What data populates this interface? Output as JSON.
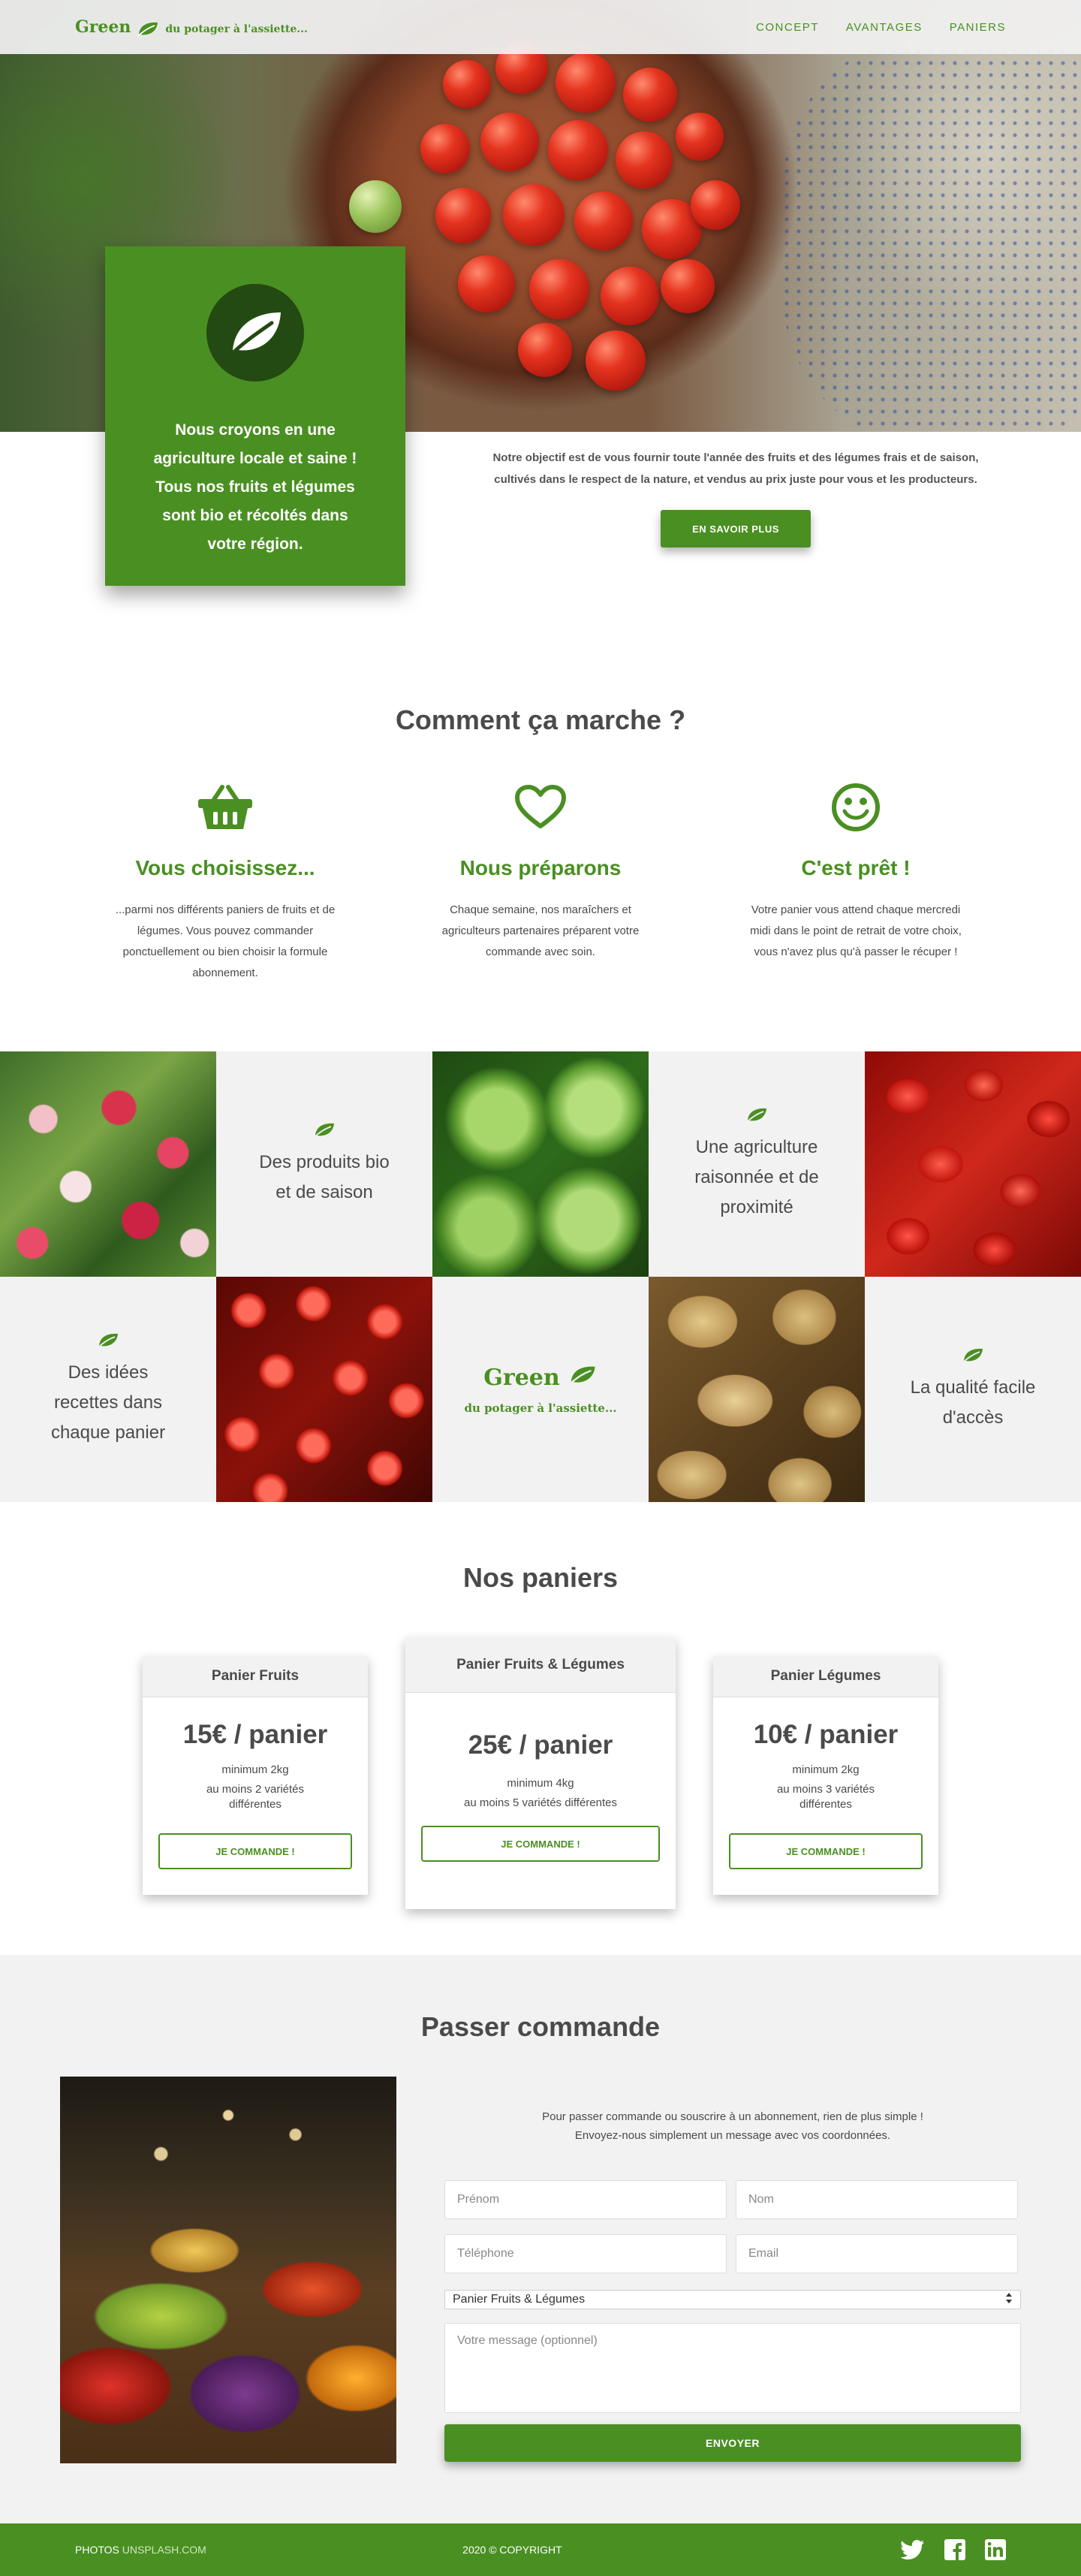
{
  "header": {
    "brand": "Green",
    "tagline": "du potager à l'assiette...",
    "nav": [
      {
        "label": "CONCEPT"
      },
      {
        "label": "AVANTAGES"
      },
      {
        "label": "PANIERS"
      }
    ]
  },
  "hero": {
    "image_icon": "tomato-bowl-photo"
  },
  "mission": {
    "card_text": "Nous croyons en une agriculture locale et saine ! Tous nos fruits et légumes sont bio et récoltés dans votre région.",
    "card_icon": "leaf-icon",
    "description": "Notre objectif est de vous fournir toute l'année des fruits et des légumes frais et de saison, cultivés dans le respect de la nature, et vendus au prix juste pour vous et les producteurs.",
    "button": "EN SAVOIR PLUS"
  },
  "how": {
    "title": "Comment ça marche ?",
    "steps": [
      {
        "icon": "basket-icon",
        "title": "Vous choisissez...",
        "text": "...parmi nos différents paniers de fruits et de légumes. Vous pouvez commander ponctuellement ou bien choisir la formule abonnement."
      },
      {
        "icon": "heart-icon",
        "title": "Nous préparons",
        "text": "Chaque semaine, nos maraîchers et agriculteurs partenaires préparent votre commande avec soin."
      },
      {
        "icon": "smile-icon",
        "title": "C'est prêt !",
        "text": "Votre panier vous attend chaque mercredi midi dans le point de retrait de votre choix, vous n'avez plus qu'à passer le récuper !"
      }
    ]
  },
  "mosaic": {
    "tiles": [
      {
        "icon": "radishes-photo"
      },
      {
        "icon": "leaf-icon",
        "text": "Des produits bio et de saison"
      },
      {
        "icon": "lettuce-photo"
      },
      {
        "icon": "leaf-icon",
        "text": "Une agriculture raisonnée et de proximité"
      },
      {
        "icon": "peppers-photo"
      },
      {
        "icon": "leaf-icon",
        "text": "Des idées recettes dans chaque panier"
      },
      {
        "icon": "tomatoes-photo"
      },
      {
        "brand": "Green",
        "tagline": "du potager à l'assiette..."
      },
      {
        "icon": "potatoes-photo"
      },
      {
        "icon": "leaf-icon",
        "text": "La qualité facile d'accès"
      }
    ]
  },
  "plans": {
    "title": "Nos paniers",
    "items": [
      {
        "name": "Panier Fruits",
        "price": "15€ / panier",
        "minimum": "minimum 2kg",
        "variety": "au moins 2 variétés différentes",
        "button": "JE COMMANDE !"
      },
      {
        "name": "Panier Fruits & Légumes",
        "price": "25€ / panier",
        "minimum": "minimum 4kg",
        "variety": "au moins 5 variétés différentes",
        "button": "JE COMMANDE !"
      },
      {
        "name": "Panier Légumes",
        "price": "10€ / panier",
        "minimum": "minimum 2kg",
        "variety": "au moins 3 variétés différentes",
        "button": "JE COMMANDE !"
      }
    ]
  },
  "order": {
    "title": "Passer commande",
    "intro_line1": "Pour passer commande ou souscrire à un abonnement, rien de plus simple !",
    "intro_line2": "Envoyez-nous simplement un message avec vos coordonnées.",
    "photo": "market-stall-photo",
    "fields": {
      "firstname_placeholder": "Prénom",
      "lastname_placeholder": "Nom",
      "phone_placeholder": "Téléphone",
      "email_placeholder": "Email",
      "select_value": "Panier Fruits & Légumes",
      "message_placeholder": "Votre message (optionnel)"
    },
    "submit": "ENVOYER"
  },
  "footer": {
    "photos_label": "PHOTOS",
    "photos_link": "UNSPLASH.COM",
    "copyright": "2020 © COPYRIGHT",
    "socials": [
      "twitter-icon",
      "facebook-icon",
      "linkedin-icon"
    ]
  },
  "colors": {
    "accent": "#4a8f22",
    "accent_dark": "#234a12",
    "background_light": "#f2f2f2",
    "text": "#4a4a4a"
  }
}
